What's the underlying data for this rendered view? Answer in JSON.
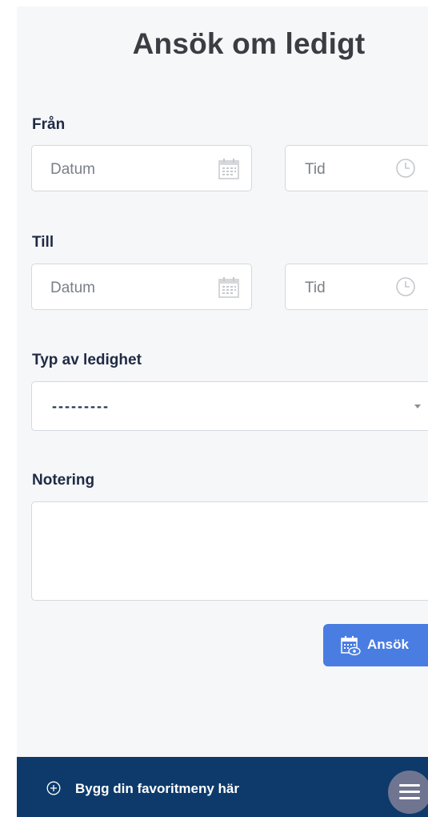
{
  "page": {
    "title": "Ansök om ledigt"
  },
  "from": {
    "label": "Från",
    "date_placeholder": "Datum",
    "time_placeholder": "Tid"
  },
  "to": {
    "label": "Till",
    "date_placeholder": "Datum",
    "time_placeholder": "Tid"
  },
  "leave_type": {
    "label": "Typ av ledighet",
    "selected": "---------"
  },
  "note": {
    "label": "Notering",
    "value": ""
  },
  "submit": {
    "label": "Ansök",
    "icon": "calendar-eye-icon"
  },
  "footer": {
    "favorite_label": "Bygg din favoritmeny här",
    "plus_icon": "plus-circle-icon",
    "menu_icon": "hamburger-icon"
  },
  "colors": {
    "accent": "#4a7de2",
    "footer_bg": "#0d3a6b",
    "menu_button": "#6f7591"
  }
}
